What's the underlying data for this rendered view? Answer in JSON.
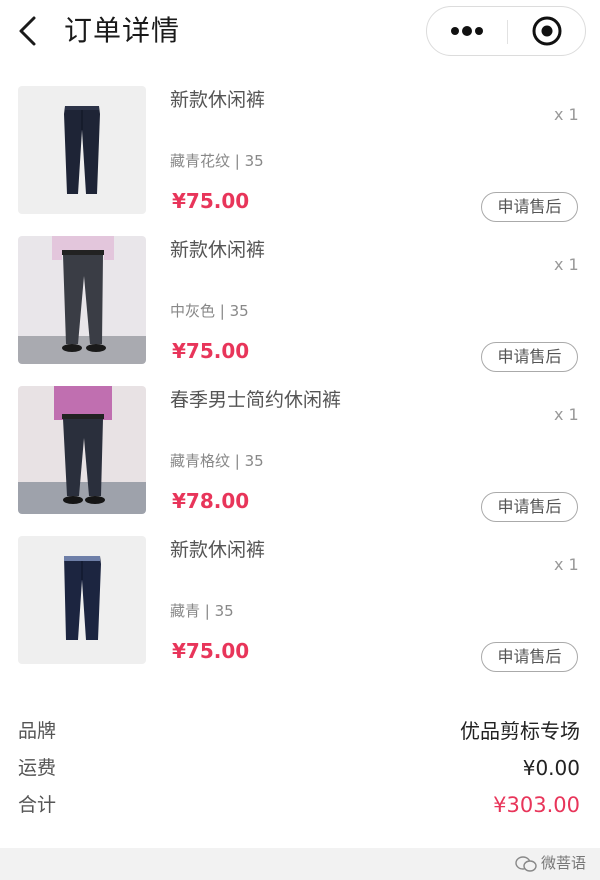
{
  "header": {
    "title": "订单详情",
    "back_icon": "chevron-left-icon",
    "more_icon": "more-dots-icon",
    "close_icon": "target-circle-icon"
  },
  "items": [
    {
      "name": "新款休闲裤",
      "spec": "藏青花纹 | 35",
      "price": "¥75.00",
      "qty": "x 1",
      "action": "申请售后",
      "image": "navy-trousers-product-photo"
    },
    {
      "name": "新款休闲裤",
      "spec": "中灰色 | 35",
      "price": "¥75.00",
      "qty": "x 1",
      "action": "申请售后",
      "image": "model-wearing-grey-trousers"
    },
    {
      "name": "春季男士简约休闲裤",
      "spec": "藏青格纹 | 35",
      "price": "¥78.00",
      "qty": "x 1",
      "action": "申请售后",
      "image": "model-wearing-navy-check-trousers"
    },
    {
      "name": "新款休闲裤",
      "spec": "藏青 | 35",
      "price": "¥75.00",
      "qty": "x 1",
      "action": "申请售后",
      "image": "navy-trousers-product-photo"
    }
  ],
  "summary": {
    "brand_label": "品牌",
    "brand_value": "优品剪标专场",
    "shipping_label": "运费",
    "shipping_value": "¥0.00",
    "total_label": "合计",
    "total_value": "¥303.00"
  },
  "watermark": "微菩语",
  "colors": {
    "price": "#e8355a",
    "text_primary": "#222222",
    "text_secondary": "#888888"
  }
}
